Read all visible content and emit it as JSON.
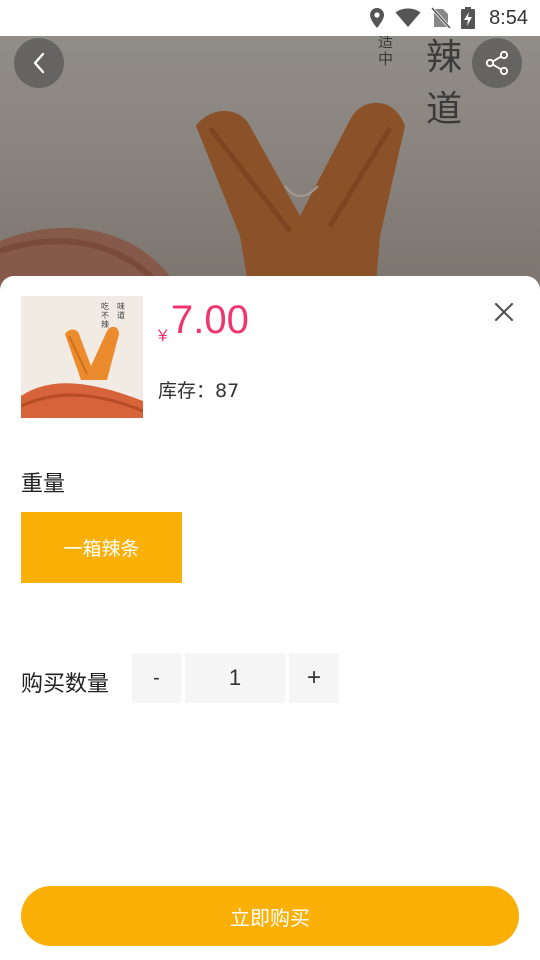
{
  "status_bar": {
    "time": "8:54",
    "icons": [
      "location-icon",
      "wifi-icon",
      "no-sim-icon",
      "battery-charging-icon"
    ]
  },
  "hero": {
    "brand_big": "辣道",
    "brand_small": "适中",
    "back_icon": "chevron-left-icon",
    "share_icon": "share-icon"
  },
  "product": {
    "currency": "¥",
    "price": "7.00",
    "stock_label": "库存：",
    "stock_value": "87",
    "thumb_text_1": "味道",
    "thumb_text_2": "吃不辣"
  },
  "spec": {
    "title": "重量",
    "option": "一箱辣条"
  },
  "quantity": {
    "label": "购买数量",
    "minus": "-",
    "value": "1",
    "plus": "+"
  },
  "actions": {
    "buy": "立即购买"
  },
  "colors": {
    "accent": "#fbb007",
    "price": "#f0346e"
  }
}
